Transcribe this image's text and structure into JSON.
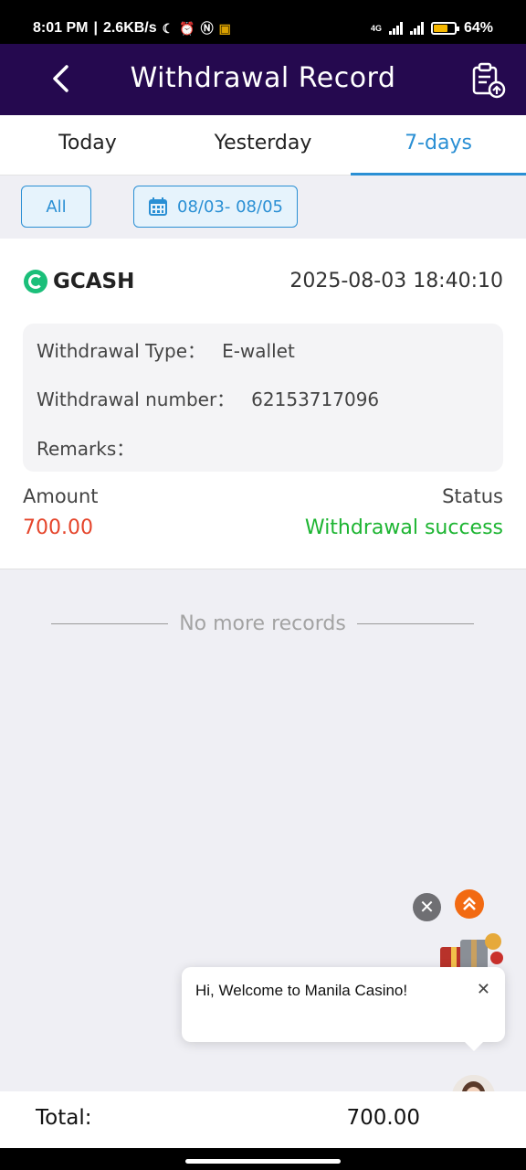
{
  "status_bar": {
    "time": "8:01 PM",
    "speed": "2.6KB/s",
    "network": "4G",
    "battery": "64%",
    "battery_level": 0.64
  },
  "header": {
    "title": "Withdrawal Record"
  },
  "tabs": [
    {
      "label": "Today",
      "active": false
    },
    {
      "label": "Yesterday",
      "active": false
    },
    {
      "label": "7-days",
      "active": true
    }
  ],
  "filters": {
    "all_label": "All",
    "date_range": "08/03- 08/05"
  },
  "record": {
    "provider": "GCASH",
    "datetime": "2025-08-03 18:40:10",
    "type_label": "Withdrawal Type：",
    "type_value": "E-wallet",
    "number_label": "Withdrawal number：",
    "number_value": "62153717096",
    "remarks_label": "Remarks：",
    "remarks_value": "",
    "amount_label": "Amount",
    "amount_value": "700.00",
    "status_label": "Status",
    "status_value": "Withdrawal success"
  },
  "list_end": "No more records",
  "chat": {
    "message": "Hi, Welcome to Manila Casino!"
  },
  "footer": {
    "total_label": "Total:",
    "total_value": "700.00"
  },
  "colors": {
    "header_bg": "#25094f",
    "accent": "#2a8fd4",
    "amount": "#e5452b",
    "success": "#1db532"
  }
}
